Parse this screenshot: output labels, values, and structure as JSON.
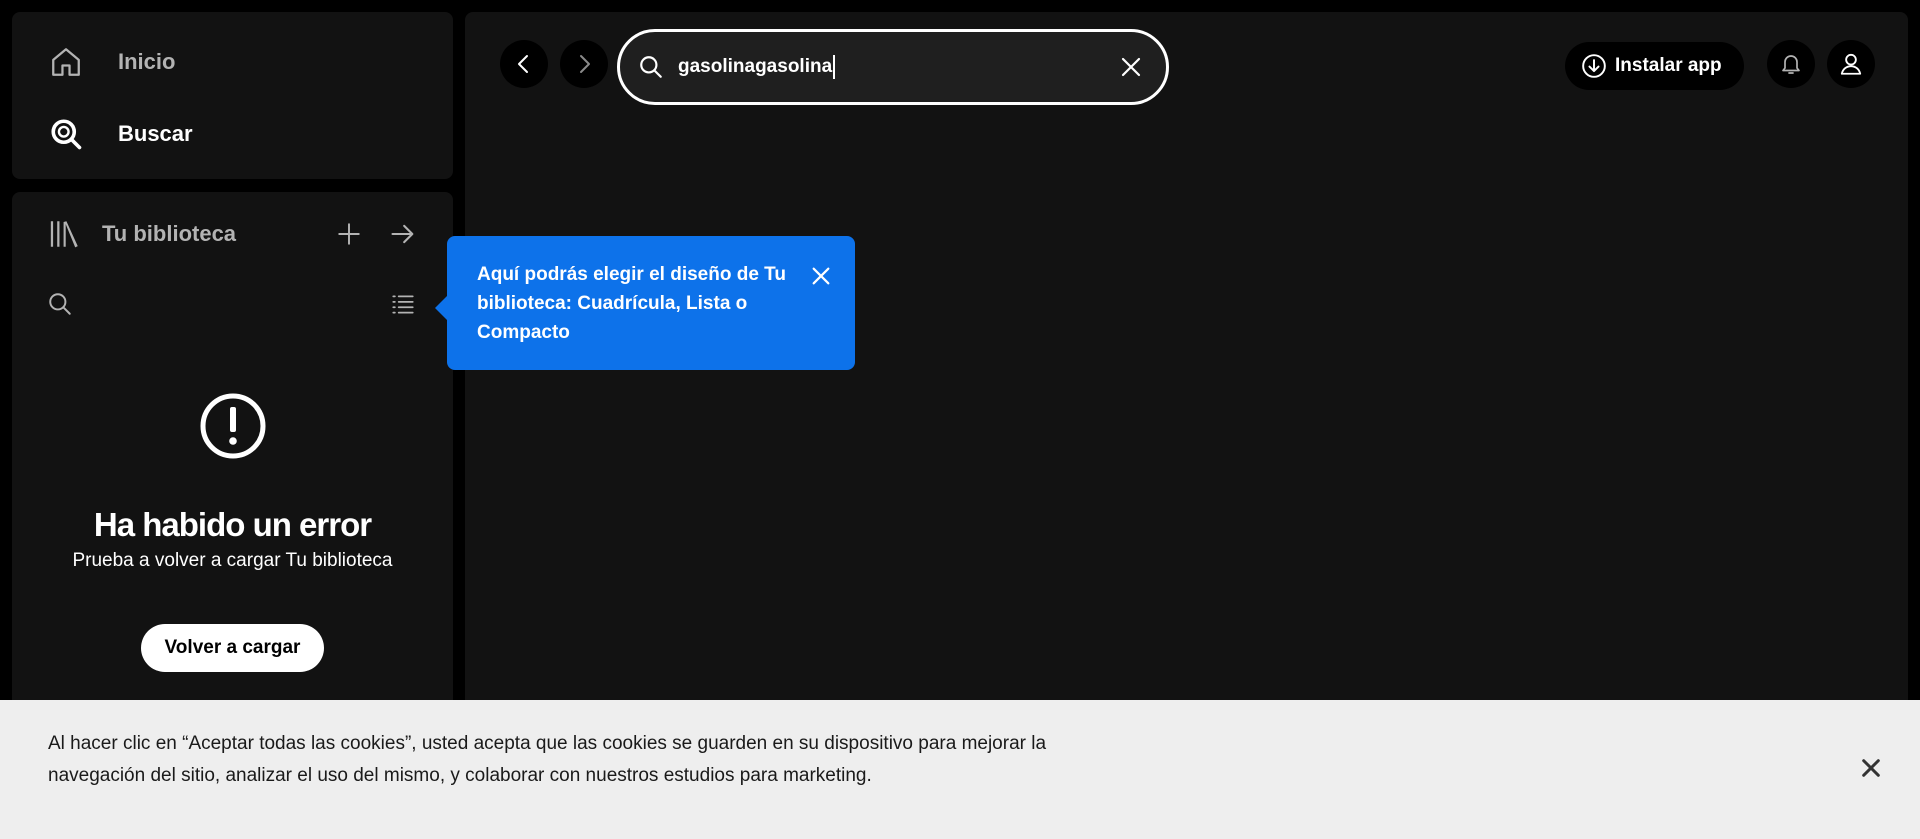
{
  "nav": {
    "items": [
      {
        "label": "Inicio",
        "icon": "home-icon",
        "active": false
      },
      {
        "label": "Buscar",
        "icon": "search-icon",
        "active": true
      }
    ]
  },
  "library": {
    "title": "Tu biblioteca",
    "error_title": "Ha habido un error",
    "error_subtitle": "Prueba a volver a cargar Tu biblioteca",
    "reload_label": "Volver a cargar"
  },
  "search": {
    "value": "gasolinagasolina"
  },
  "topbar": {
    "install_label": "Instalar app"
  },
  "tooltip": {
    "text": "Aquí podrás elegir el diseño de Tu biblioteca: Cuadrícula, Lista o Compacto"
  },
  "cookie": {
    "text": "Al hacer clic en “Aceptar todas las cookies”, usted acepta que las cookies se guarden en su dispositivo para mejorar la navegación del sitio, analizar el uso del mismo, y colaborar con nuestros estudios para marketing."
  },
  "colors": {
    "background": "#000000",
    "panel": "#121212",
    "tooltip": "#0d72ea",
    "banner": "#eeeeee",
    "muted_text": "#b3b3b3"
  }
}
